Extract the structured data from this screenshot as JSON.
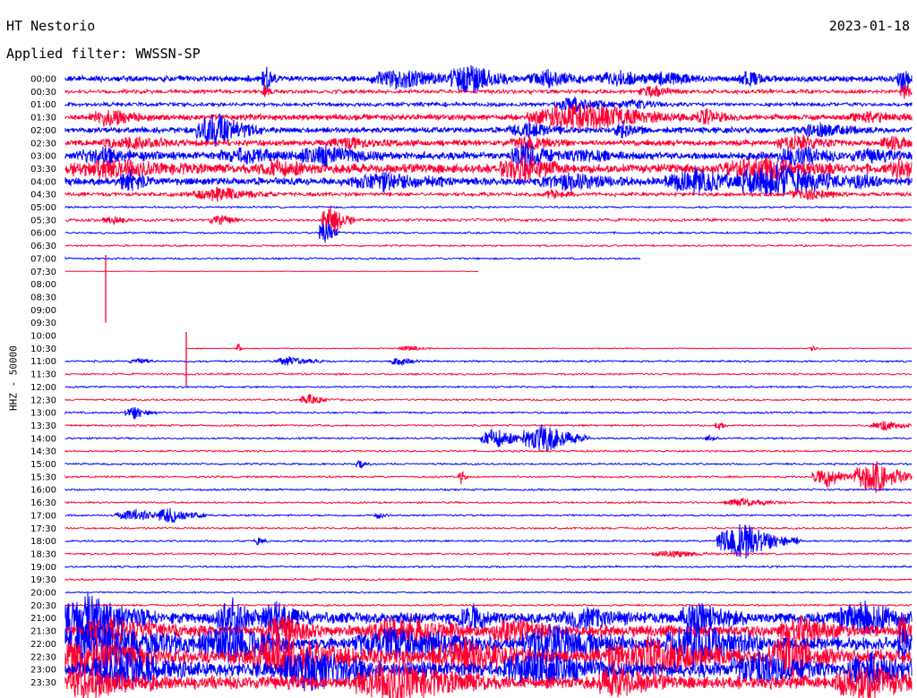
{
  "header": {
    "station": "HT Nestorio",
    "date": "2023-01-18",
    "filter": "Applied filter: WWSSN-SP"
  },
  "axis": {
    "channel_label": "HHZ - 50000"
  },
  "colors": {
    "even_row": "#0000ff",
    "odd_row": "#ff0033"
  },
  "time_labels": [
    "00:00",
    "00:30",
    "01:00",
    "01:30",
    "02:00",
    "02:30",
    "03:00",
    "03:30",
    "04:00",
    "04:30",
    "05:00",
    "05:30",
    "06:00",
    "06:30",
    "07:00",
    "07:30",
    "08:00",
    "08:30",
    "09:00",
    "09:30",
    "10:00",
    "10:30",
    "11:00",
    "11:30",
    "12:00",
    "12:30",
    "13:00",
    "13:30",
    "14:00",
    "14:30",
    "15:00",
    "15:30",
    "16:00",
    "16:30",
    "17:00",
    "17:30",
    "18:00",
    "18:30",
    "19:00",
    "19:30",
    "20:00",
    "20:30",
    "21:00",
    "21:30",
    "22:00",
    "22:30",
    "23:00",
    "23:30"
  ]
}
